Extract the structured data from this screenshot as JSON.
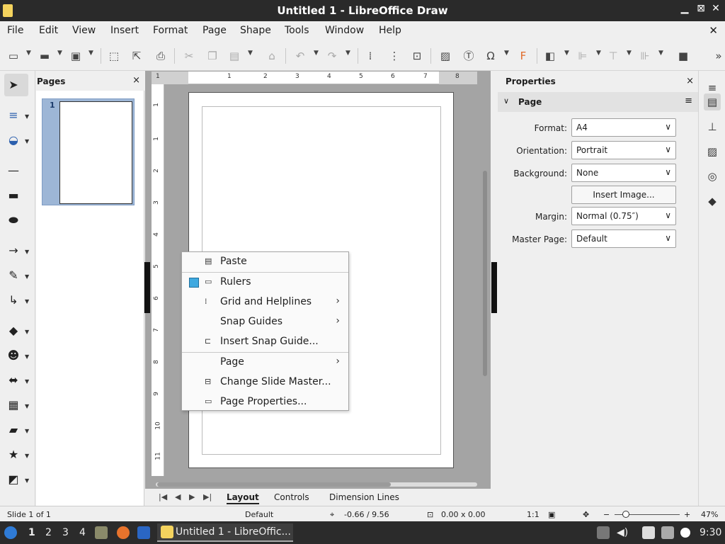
{
  "window": {
    "title": "Untitled 1 - LibreOffice Draw",
    "minimize": "▁",
    "restore": "⊠",
    "close": "✕"
  },
  "menu": {
    "items": [
      "File",
      "Edit",
      "View",
      "Insert",
      "Format",
      "Page",
      "Shape",
      "Tools",
      "Window",
      "Help"
    ],
    "close": "✕"
  },
  "pages_pane": {
    "title": "Pages",
    "close": "×",
    "thumb_number": "1"
  },
  "ruler": {
    "h_numbers": [
      "1",
      "1",
      "2",
      "3",
      "4",
      "5",
      "6",
      "7",
      "8"
    ],
    "v_numbers": [
      "1",
      "1",
      "2",
      "3",
      "4",
      "5",
      "6",
      "7",
      "8",
      "9",
      "10",
      "11"
    ]
  },
  "context_menu": {
    "paste": "Paste",
    "rulers": "Rulers",
    "grid": "Grid and Helplines",
    "snap_guides": "Snap Guides",
    "insert_snap": "Insert Snap Guide...",
    "page": "Page",
    "change_master": "Change Slide Master...",
    "page_props": "Page Properties...",
    "submenu_arrow": "›"
  },
  "sidebar": {
    "title": "Properties",
    "close": "×",
    "section": "Page",
    "format_label": "Format:",
    "format_value": "A4",
    "orientation_label": "Orientation:",
    "orientation_value": "Portrait",
    "background_label": "Background:",
    "background_value": "None",
    "insert_image": "Insert Image...",
    "margin_label": "Margin:",
    "margin_value": "Normal (0.75″)",
    "master_label": "Master Page:",
    "master_value": "Default"
  },
  "tabs": {
    "layout": "Layout",
    "controls": "Controls",
    "dimension": "Dimension Lines"
  },
  "status": {
    "slide": "Slide 1 of 1",
    "master": "Default",
    "position": "-0.66 / 9.56",
    "size": "0.00 x 0.00",
    "scale": "1:1",
    "zoom_minus": "−",
    "zoom_plus": "+",
    "zoom": "47%"
  },
  "taskbar": {
    "workspaces": [
      "1",
      "2",
      "3",
      "4"
    ],
    "window": "Untitled 1 - LibreOffic...",
    "clock": "9:30"
  },
  "colors": {
    "accent": "#3fa9e0",
    "thumb_selection": "#9db6d6"
  }
}
